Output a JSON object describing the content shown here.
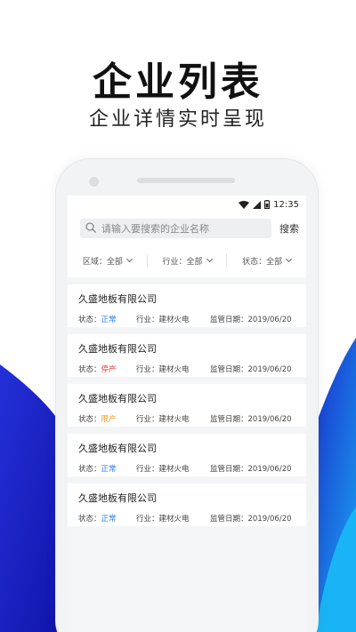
{
  "hero": {
    "title": "企业列表",
    "subtitle": "企业详情实时呈现"
  },
  "statusbar": {
    "time": "12:35"
  },
  "search": {
    "placeholder": "请输入要搜索的企业名称",
    "button": "搜索"
  },
  "filters": [
    {
      "label": "区域：全部"
    },
    {
      "label": "行业：全部"
    },
    {
      "label": "状态：全部"
    }
  ],
  "labels": {
    "status": "状态：",
    "industry": "行业：",
    "date": "监管日期："
  },
  "companies": [
    {
      "name": "久盛地板有限公司",
      "status": "正常",
      "industry": "建材火电",
      "date": "2019/06/20"
    },
    {
      "name": "久盛地板有限公司",
      "status": "停产",
      "industry": "建材火电",
      "date": "2019/06/20"
    },
    {
      "name": "久盛地板有限公司",
      "status": "限产",
      "industry": "建材火电",
      "date": "2019/06/20"
    },
    {
      "name": "久盛地板有限公司",
      "status": "正常",
      "industry": "建材火电",
      "date": "2019/06/20"
    },
    {
      "name": "久盛地板有限公司",
      "status": "正常",
      "industry": "建材火电",
      "date": "2019/06/20"
    }
  ],
  "colors": {
    "normal": "#2f7fe0",
    "stopped": "#e03030",
    "limited": "#f09a1a",
    "wave_dark": "#1a1ec8",
    "wave_light": "#1aa0f0"
  }
}
